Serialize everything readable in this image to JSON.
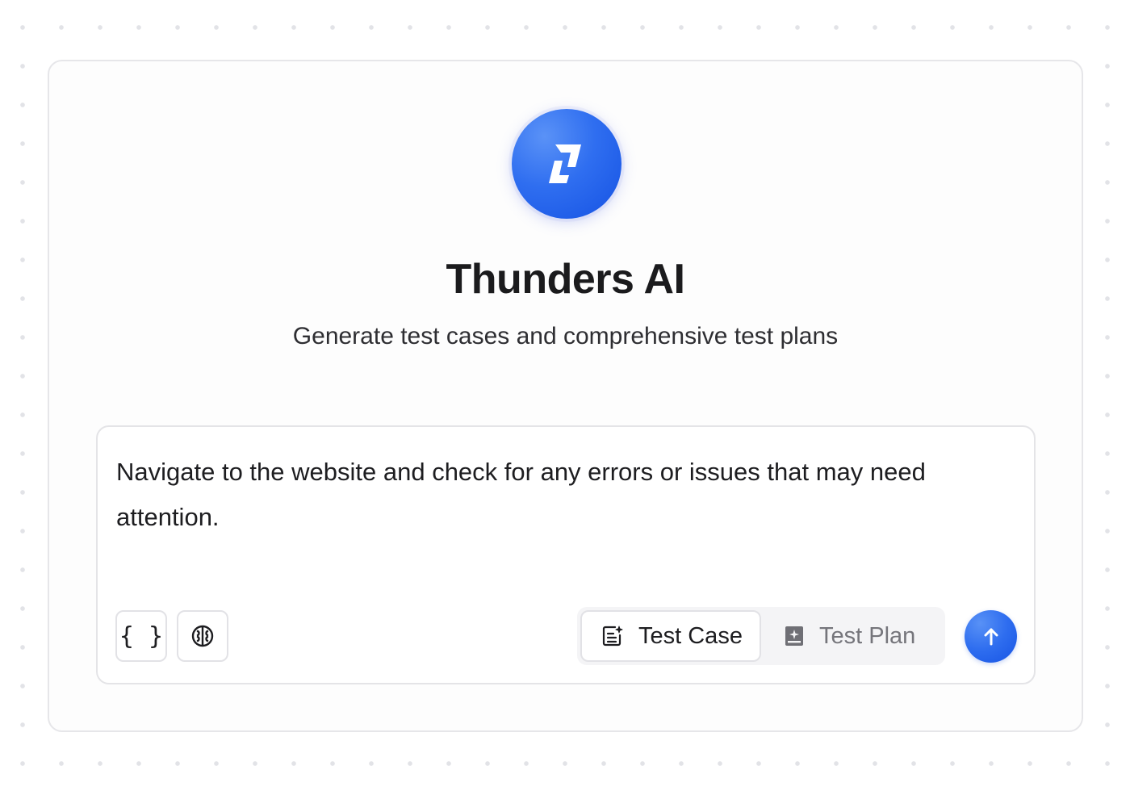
{
  "app": {
    "title": "Thunders AI",
    "subtitle": "Generate test cases and comprehensive test plans",
    "logo_icon": "thunders-logo-icon",
    "accent_color": "#2f6ef0"
  },
  "composer": {
    "prompt_text": "Navigate to the website and check for any errors or issues that may need attention.",
    "tools": [
      {
        "icon": "braces-icon",
        "glyph": "{ }"
      },
      {
        "icon": "brain-icon"
      }
    ],
    "modes": [
      {
        "label": "Test Case",
        "icon": "test-case-icon",
        "selected": true
      },
      {
        "label": "Test Plan",
        "icon": "test-plan-icon",
        "selected": false
      }
    ],
    "send_icon": "arrow-up-icon"
  }
}
